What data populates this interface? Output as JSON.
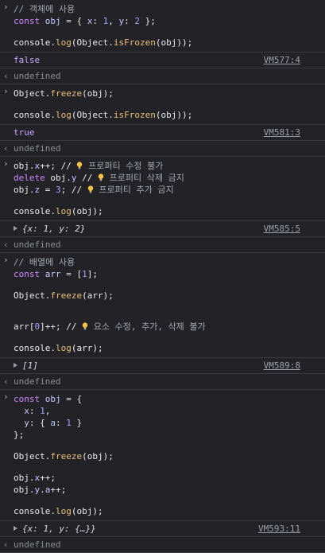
{
  "blocks": [
    {
      "code": [
        [
          {
            "t": "// 객체에 사용",
            "c": "cmt"
          }
        ],
        [
          {
            "t": "const ",
            "c": "kw"
          },
          {
            "t": "obj",
            "c": "prop"
          },
          {
            "t": " = { ",
            "c": "plain"
          },
          {
            "t": "x",
            "c": "prop"
          },
          {
            "t": ": ",
            "c": "plain"
          },
          {
            "t": "1",
            "c": "num"
          },
          {
            "t": ", ",
            "c": "plain"
          },
          {
            "t": "y",
            "c": "prop"
          },
          {
            "t": ": ",
            "c": "plain"
          },
          {
            "t": "2",
            "c": "num"
          },
          {
            "t": " };",
            "c": "plain"
          }
        ],
        [],
        [
          {
            "t": "console",
            "c": "plain"
          },
          {
            "t": ".",
            "c": "plain"
          },
          {
            "t": "log",
            "c": "fn"
          },
          {
            "t": "(Object.",
            "c": "plain"
          },
          {
            "t": "isFrozen",
            "c": "fn"
          },
          {
            "t": "(obj));",
            "c": "plain"
          }
        ]
      ],
      "output": {
        "text": "false",
        "cls": "bool",
        "vm": "VM577:4"
      },
      "undef": "undefined"
    },
    {
      "code": [
        [
          {
            "t": "Object.",
            "c": "plain"
          },
          {
            "t": "freeze",
            "c": "fn"
          },
          {
            "t": "(obj);",
            "c": "plain"
          }
        ],
        [],
        [
          {
            "t": "console",
            "c": "plain"
          },
          {
            "t": ".",
            "c": "plain"
          },
          {
            "t": "log",
            "c": "fn"
          },
          {
            "t": "(Object.",
            "c": "plain"
          },
          {
            "t": "isFrozen",
            "c": "fn"
          },
          {
            "t": "(obj));",
            "c": "plain"
          }
        ]
      ],
      "output": {
        "text": "true",
        "cls": "bool",
        "vm": "VM581:3"
      },
      "undef": "undefined"
    },
    {
      "code": [
        [
          {
            "t": "obj.",
            "c": "plain"
          },
          {
            "t": "x",
            "c": "prop"
          },
          {
            "t": "++; // ",
            "c": "plain"
          },
          {
            "t": "💡",
            "c": "bulb"
          },
          {
            "t": " 프로퍼티 수정 불가",
            "c": "cmt"
          }
        ],
        [
          {
            "t": "delete ",
            "c": "kw"
          },
          {
            "t": "obj.",
            "c": "plain"
          },
          {
            "t": "y",
            "c": "prop"
          },
          {
            "t": " // ",
            "c": "plain"
          },
          {
            "t": "💡",
            "c": "bulb"
          },
          {
            "t": " 프로퍼티 삭제 금지",
            "c": "cmt"
          }
        ],
        [
          {
            "t": "obj.",
            "c": "plain"
          },
          {
            "t": "z",
            "c": "prop"
          },
          {
            "t": " = ",
            "c": "plain"
          },
          {
            "t": "3",
            "c": "num"
          },
          {
            "t": "; // ",
            "c": "plain"
          },
          {
            "t": "💡",
            "c": "bulb"
          },
          {
            "t": " 프로퍼티 추가 금지",
            "c": "cmt"
          }
        ],
        [],
        [
          {
            "t": "console",
            "c": "plain"
          },
          {
            "t": ".",
            "c": "plain"
          },
          {
            "t": "log",
            "c": "fn"
          },
          {
            "t": "(obj);",
            "c": "plain"
          }
        ]
      ],
      "output": {
        "text": "{x: 1, y: 2}",
        "cls": "obj",
        "vm": "VM585:5",
        "expand": true
      },
      "undef": "undefined"
    },
    {
      "code": [
        [
          {
            "t": "// 배열에 사용",
            "c": "cmt"
          }
        ],
        [
          {
            "t": "const ",
            "c": "kw"
          },
          {
            "t": "arr",
            "c": "prop"
          },
          {
            "t": " = [",
            "c": "plain"
          },
          {
            "t": "1",
            "c": "num"
          },
          {
            "t": "];",
            "c": "plain"
          }
        ],
        [],
        [
          {
            "t": "Object.",
            "c": "plain"
          },
          {
            "t": "freeze",
            "c": "fn"
          },
          {
            "t": "(arr);",
            "c": "plain"
          }
        ],
        [],
        [],
        [
          {
            "t": "arr[",
            "c": "plain"
          },
          {
            "t": "0",
            "c": "num"
          },
          {
            "t": "]++; // ",
            "c": "plain"
          },
          {
            "t": "💡",
            "c": "bulb"
          },
          {
            "t": " 요소 수정, 추가, 삭제 불가",
            "c": "cmt"
          }
        ],
        [],
        [
          {
            "t": "console",
            "c": "plain"
          },
          {
            "t": ".",
            "c": "plain"
          },
          {
            "t": "log",
            "c": "fn"
          },
          {
            "t": "(arr);",
            "c": "plain"
          }
        ]
      ],
      "output": {
        "text": "[1]",
        "cls": "obj",
        "vm": "VM589:8",
        "expand": true
      },
      "undef": "undefined"
    },
    {
      "code": [
        [
          {
            "t": "const ",
            "c": "kw"
          },
          {
            "t": "obj",
            "c": "prop"
          },
          {
            "t": " = {",
            "c": "plain"
          }
        ],
        [
          {
            "t": "  ",
            "c": "plain"
          },
          {
            "t": "x",
            "c": "prop"
          },
          {
            "t": ": ",
            "c": "plain"
          },
          {
            "t": "1",
            "c": "num"
          },
          {
            "t": ",",
            "c": "plain"
          }
        ],
        [
          {
            "t": "  ",
            "c": "plain"
          },
          {
            "t": "y",
            "c": "prop"
          },
          {
            "t": ": { ",
            "c": "plain"
          },
          {
            "t": "a",
            "c": "prop"
          },
          {
            "t": ": ",
            "c": "plain"
          },
          {
            "t": "1",
            "c": "num"
          },
          {
            "t": " }",
            "c": "plain"
          }
        ],
        [
          {
            "t": "};",
            "c": "plain"
          }
        ],
        [],
        [
          {
            "t": "Object.",
            "c": "plain"
          },
          {
            "t": "freeze",
            "c": "fn"
          },
          {
            "t": "(obj);",
            "c": "plain"
          }
        ],
        [],
        [
          {
            "t": "obj.",
            "c": "plain"
          },
          {
            "t": "x",
            "c": "prop"
          },
          {
            "t": "++;",
            "c": "plain"
          }
        ],
        [
          {
            "t": "obj.",
            "c": "plain"
          },
          {
            "t": "y",
            "c": "prop"
          },
          {
            "t": ".",
            "c": "plain"
          },
          {
            "t": "a",
            "c": "prop"
          },
          {
            "t": "++;",
            "c": "plain"
          }
        ],
        [],
        [
          {
            "t": "console",
            "c": "plain"
          },
          {
            "t": ".",
            "c": "plain"
          },
          {
            "t": "log",
            "c": "fn"
          },
          {
            "t": "(obj);",
            "c": "plain"
          }
        ]
      ],
      "output": {
        "text": "{x: 1, y: {…}}",
        "cls": "obj",
        "vm": "VM593:11",
        "expand": true
      },
      "undef": "undefined"
    }
  ],
  "icons": {
    "prompt": "chevron-right-icon",
    "result": "return-arrow-icon",
    "expand": "triangle-right-icon",
    "bulb": "light-bulb-icon"
  }
}
